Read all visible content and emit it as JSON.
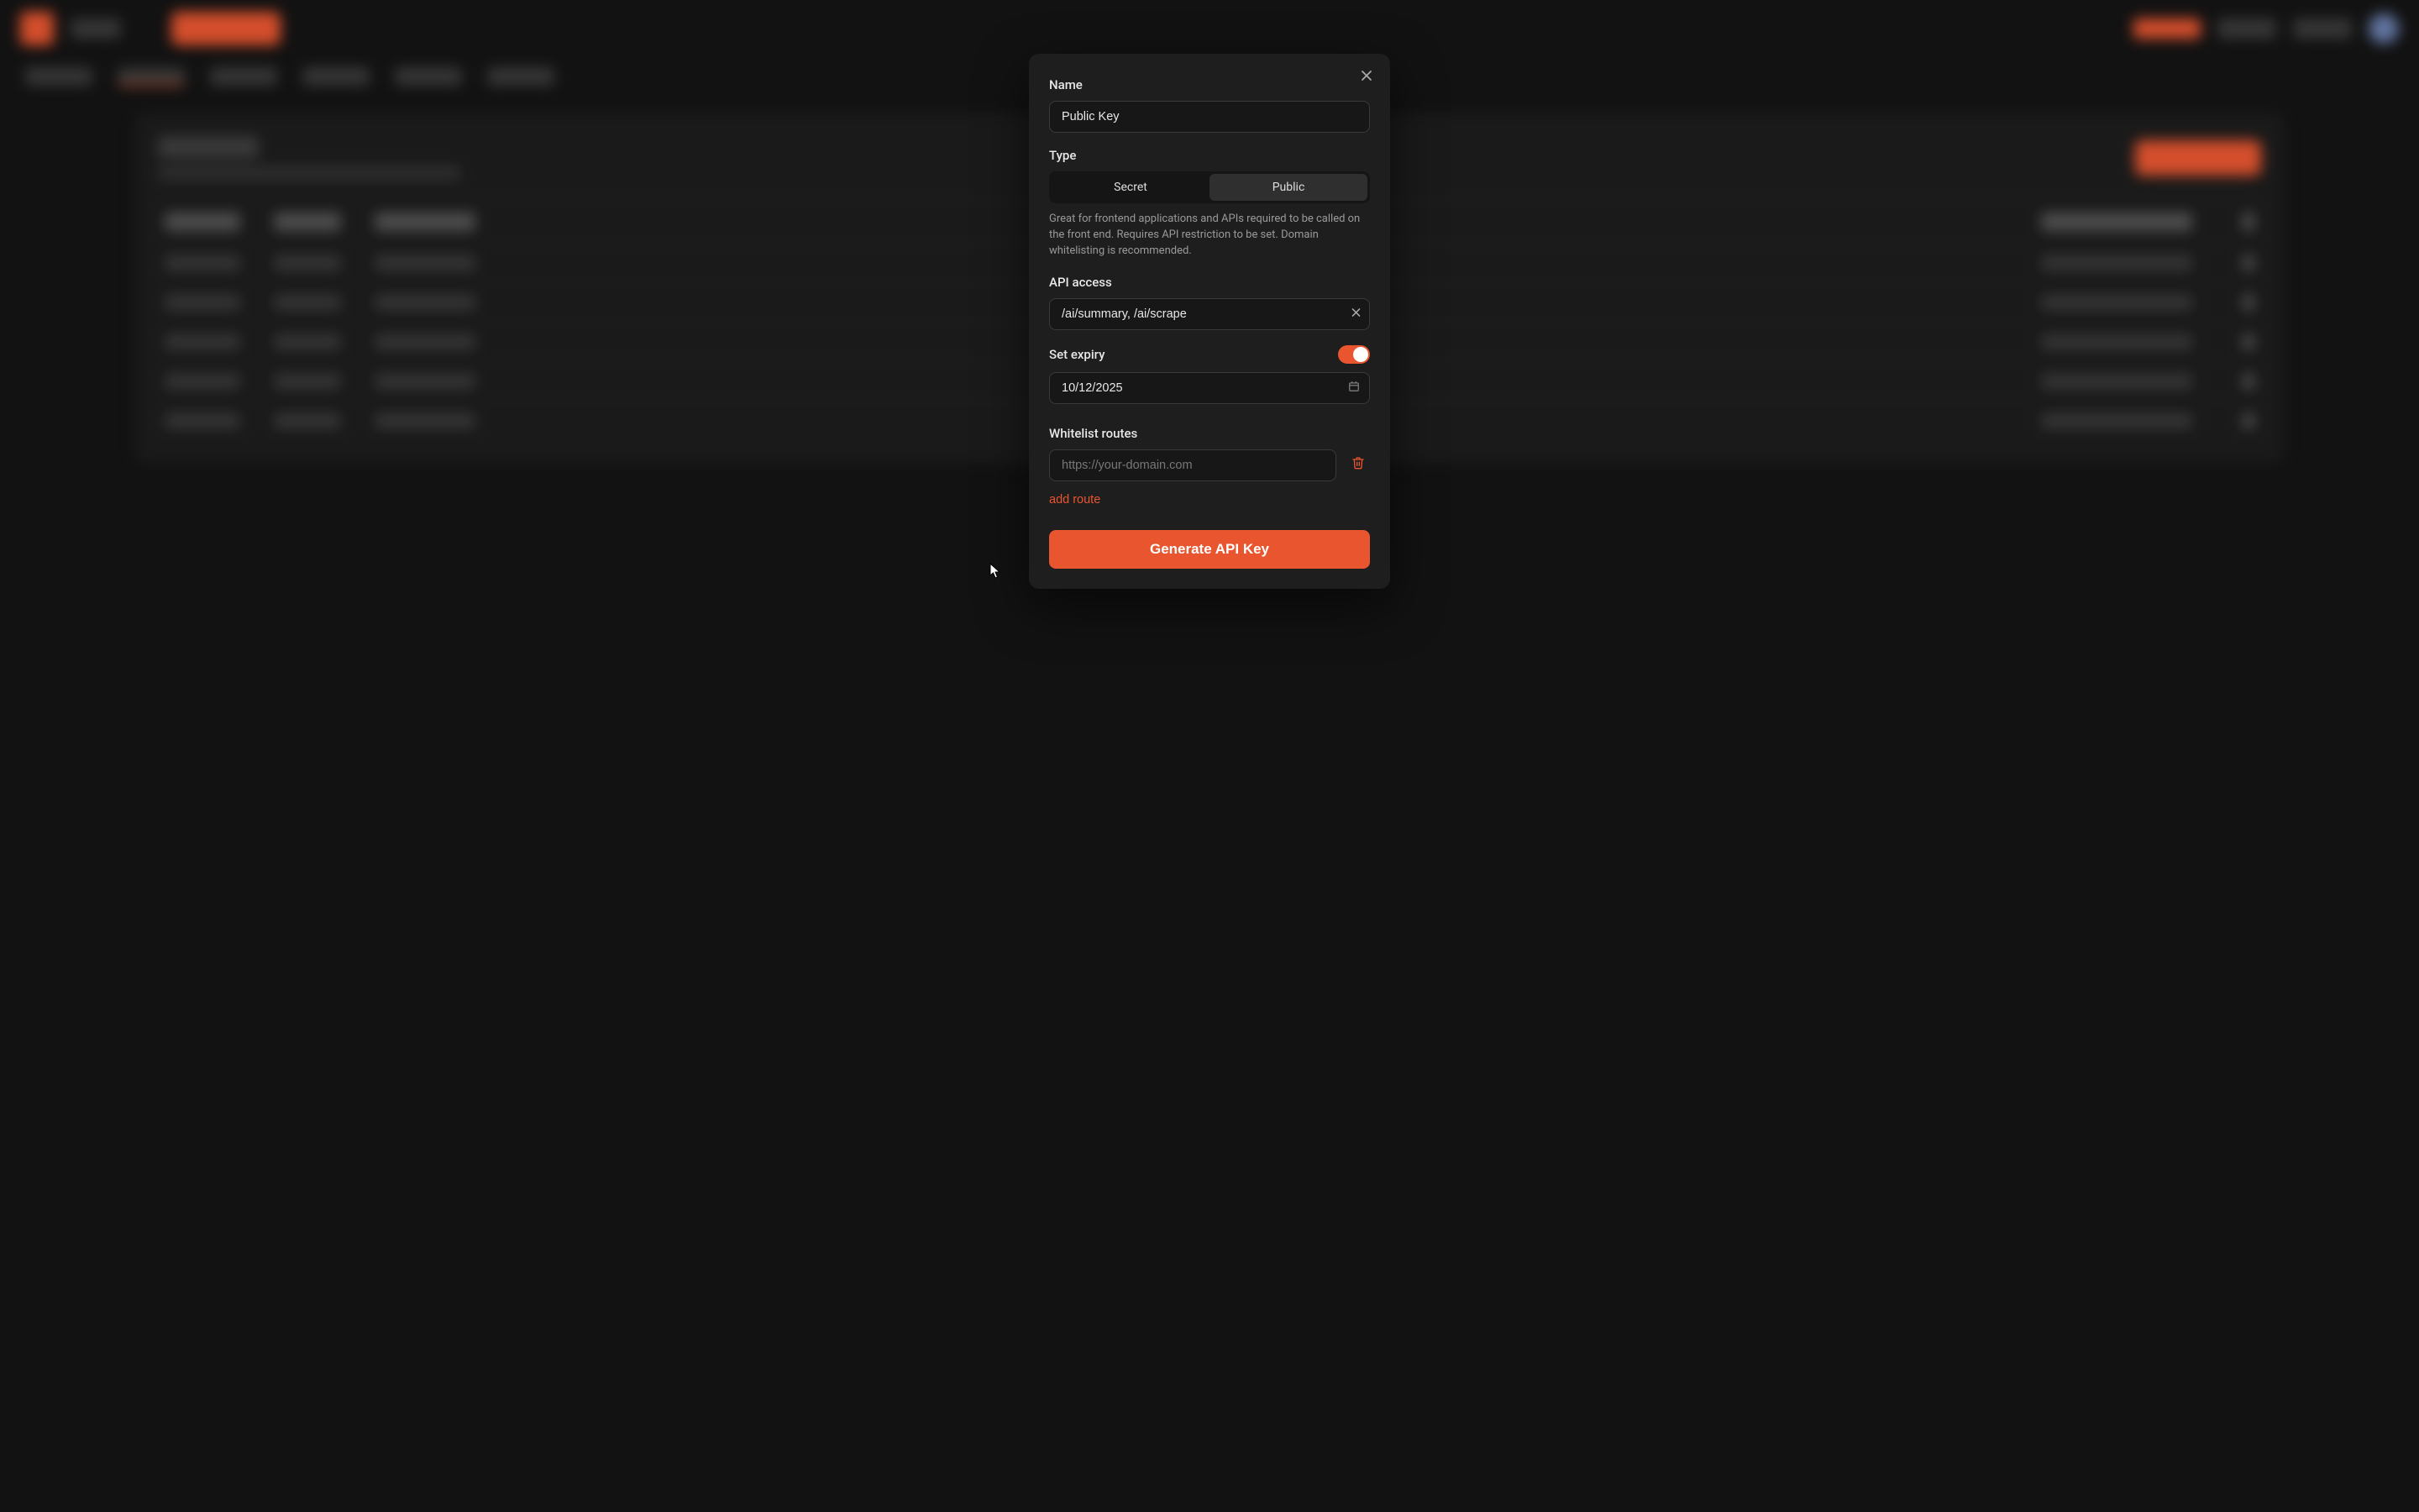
{
  "modal": {
    "name_label": "Name",
    "name_value": "Public Key",
    "type_label": "Type",
    "type_options": {
      "secret": "Secret",
      "public": "Public"
    },
    "type_help": "Great for frontend applications and APIs required to be called on the front end. Requires API restriction to be set. Domain whitelisting is recommended.",
    "api_access_label": "API access",
    "api_access_value": "/ai/summary, /ai/scrape",
    "expiry_label": "Set expiry",
    "expiry_enabled": true,
    "expiry_value": "10/12/2025",
    "whitelist_label": "Whitelist routes",
    "whitelist_route_value": "",
    "whitelist_route_placeholder": "https://your-domain.com",
    "add_route_label": "add route",
    "submit_label": "Generate API Key"
  },
  "colors": {
    "accent": "#e9552f",
    "bg": "#121212",
    "panel": "#1e1e1e",
    "input_bg": "#171717",
    "border": "#3a3a3a"
  }
}
